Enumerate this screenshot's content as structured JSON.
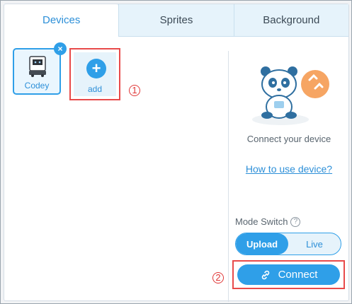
{
  "tabs": [
    {
      "label": "Devices",
      "active": true
    },
    {
      "label": "Sprites",
      "active": false
    },
    {
      "label": "Background",
      "active": false
    }
  ],
  "devices": [
    {
      "name": "Codey",
      "icon": "robot-icon",
      "selected": true
    }
  ],
  "add_tile": {
    "label": "add",
    "icon": "plus-icon"
  },
  "markers": {
    "one": "1",
    "two": "2"
  },
  "right_panel": {
    "connect_text": "Connect your device",
    "help_link": "How to use device?",
    "mode_label": "Mode Switch",
    "modes": [
      {
        "label": "Upload",
        "active": true
      },
      {
        "label": "Live",
        "active": false
      }
    ],
    "connect_button": "Connect"
  },
  "colors": {
    "accent": "#2f9fe8",
    "highlight_box": "#e84a4a",
    "tab_bg": "#e6f3fb"
  }
}
